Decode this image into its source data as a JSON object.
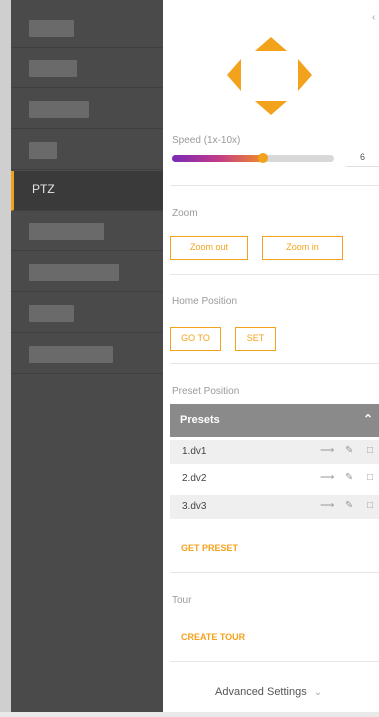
{
  "sidebar": {
    "active_label": "PTZ"
  },
  "ptz": {
    "speed_label": "Speed (1x-10x)",
    "speed_value": "6",
    "speed_fraction": 0.56
  },
  "zoom": {
    "label": "Zoom",
    "zoom_out": "Zoom out",
    "zoom_in": "Zoom in"
  },
  "home": {
    "label": "Home Position",
    "go_to": "GO TO",
    "set": "SET"
  },
  "preset": {
    "label": "Preset Position",
    "header": "Presets",
    "items": [
      "1.dv1",
      "2.dv2",
      "3.dv3"
    ],
    "get_preset": "GET PRESET"
  },
  "tour": {
    "label": "Tour",
    "create": "CREATE TOUR"
  },
  "advanced": {
    "label": "Advanced Settings"
  },
  "colors": {
    "accent": "#f3a21b",
    "sidebar_bg": "#4a4a4a",
    "preset_header": "#8a8a8a"
  },
  "icons": [
    "arrow-up-icon",
    "arrow-down-icon",
    "arrow-left-icon",
    "arrow-right-icon",
    "go-arrow-icon",
    "pencil-icon",
    "trash-icon",
    "chevron-up-icon",
    "chevron-down-icon",
    "collapse-icon"
  ]
}
